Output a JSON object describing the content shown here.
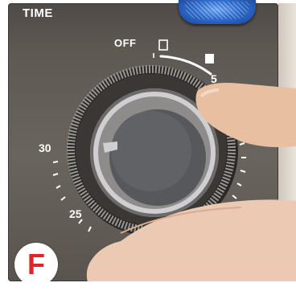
{
  "panel": {
    "title": "TIME"
  },
  "dial": {
    "off_label": "OFF",
    "markings": [
      "5",
      "30",
      "25"
    ]
  },
  "badge": {
    "letter": "F"
  },
  "colors": {
    "panel": "#5f5954",
    "badge_letter": "#e0242b",
    "blue_button": "#2f6fd6"
  },
  "icons": [
    "off-square-outline-icon",
    "filled-square-icon"
  ]
}
